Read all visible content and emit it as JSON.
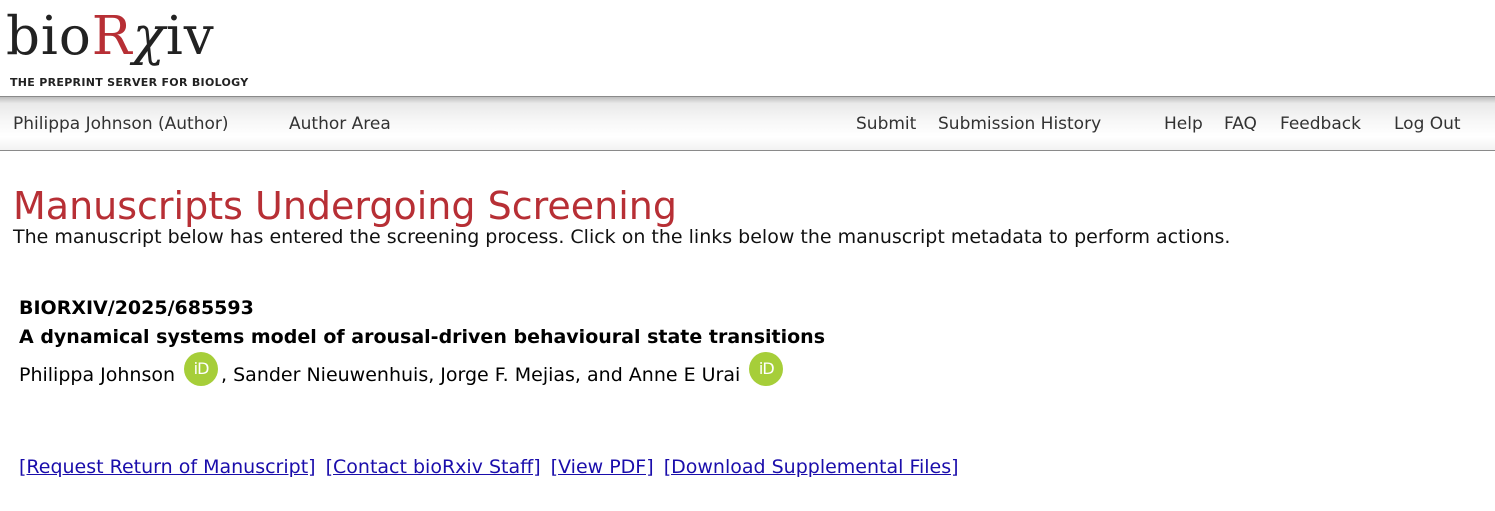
{
  "logo": {
    "word_prefix": "bio",
    "word_r": "R",
    "word_x": "χ",
    "word_suffix": "iv",
    "tagline": "THE PREPRINT SERVER FOR BIOLOGY"
  },
  "nav": {
    "user": "Philippa Johnson (Author)",
    "author_area": "Author Area",
    "submit": "Submit",
    "submission_history": "Submission History",
    "help": "Help",
    "faq": "FAQ",
    "feedback": "Feedback",
    "logout": "Log Out"
  },
  "page": {
    "title": "Manuscripts Undergoing Screening",
    "intro": "The manuscript below has entered the screening process. Click on the links below the manuscript metadata to perform actions."
  },
  "manuscript": {
    "id": "BIORXIV/2025/685593",
    "title": "A dynamical systems model of arousal-driven behavioural state transitions",
    "author_first": "Philippa Johnson",
    "authors_middle": ", Sander Nieuwenhuis, Jorge F. Mejias, and Anne E Urai",
    "orcid_label": "iD",
    "orcid_color": "#a6ce39"
  },
  "actions": {
    "request_return": "[Request Return of Manuscript]",
    "contact_staff": "[Contact bioRxiv Staff]",
    "view_pdf": "[View PDF]",
    "download_supp": "[Download Supplemental Files]"
  },
  "colors": {
    "brand_red": "#b72f35",
    "link_blue": "#1a0dab"
  }
}
